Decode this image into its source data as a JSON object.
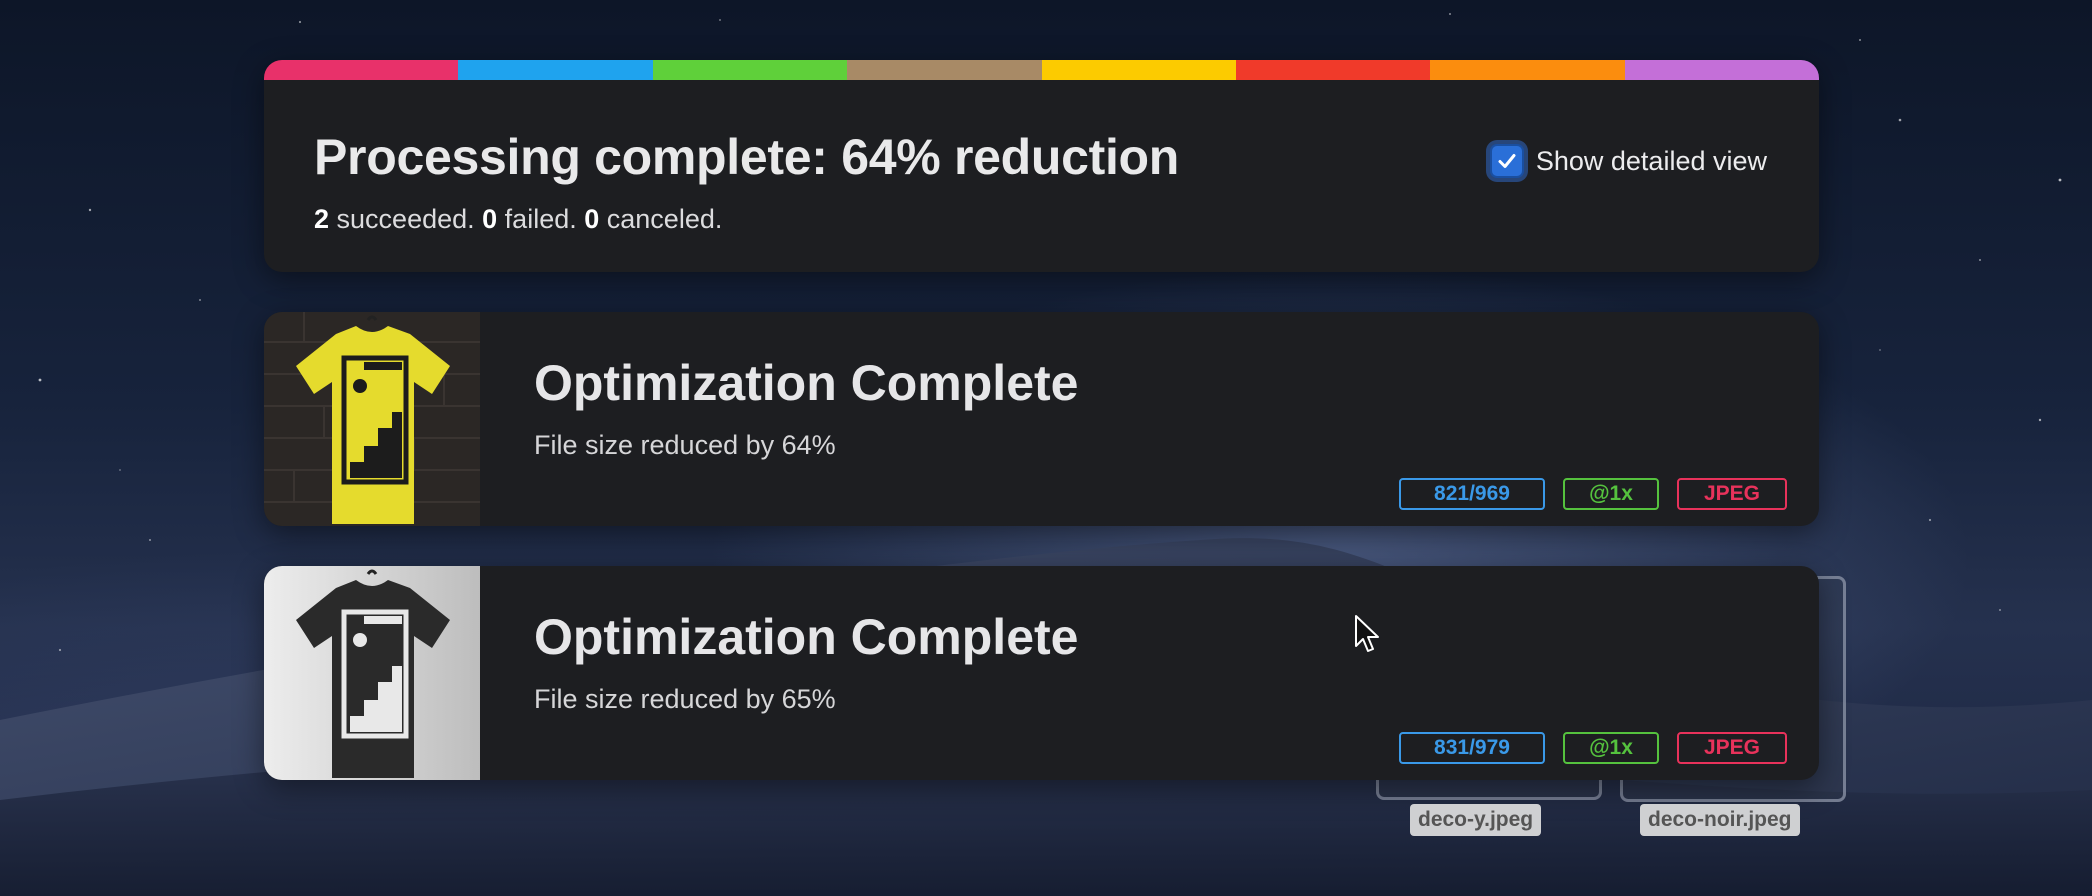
{
  "summary": {
    "rainbow_colors": [
      "#e8316a",
      "#1fa3ee",
      "#5fd03a",
      "#a88a66",
      "#fccb00",
      "#f03a2a",
      "#fb8d0e",
      "#c46fd8"
    ],
    "title": "Processing complete: 64% reduction",
    "succeeded_count": "2",
    "succeeded_text": " succeeded. ",
    "failed_count": "0",
    "failed_text": " failed. ",
    "canceled_count": "0",
    "canceled_text": " canceled.",
    "toggle_label": "Show detailed view",
    "toggle_checked": true
  },
  "results": [
    {
      "title": "Optimization Complete",
      "subtitle": "File size reduced by 64%",
      "thumbnail": "yellow-tshirt-image",
      "dimensions": "821/969",
      "scale": "@1x",
      "format": "JPEG"
    },
    {
      "title": "Optimization Complete",
      "subtitle": "File size reduced by 65%",
      "thumbnail": "black-tshirt-image",
      "dimensions": "831/979",
      "scale": "@1x",
      "format": "JPEG"
    }
  ],
  "dragged_files": [
    "deco-y.jpeg",
    "deco-noir.jpeg"
  ],
  "colors": {
    "panel_bg": "#1d1e21",
    "accent_blue": "#3a99e8",
    "accent_green": "#55c23e",
    "accent_red": "#e8325b"
  }
}
